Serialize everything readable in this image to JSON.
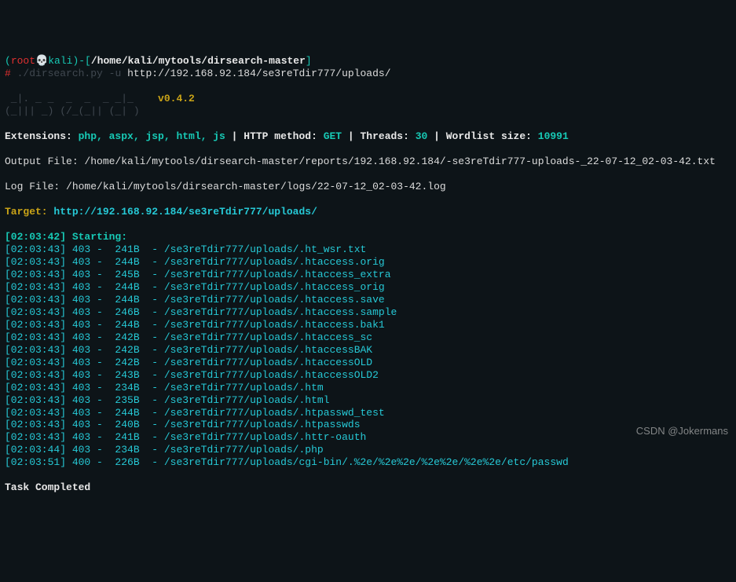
{
  "prompt": {
    "lparen": "(",
    "user": "root",
    "skull": "💀",
    "host": "kali",
    "rparen": ")-",
    "lbracket": "[",
    "cwd": "/home/kali/mytools/dirsearch-master",
    "rbracket": "]",
    "hash": "#",
    "cmd_bin": " ./dirsearch.py",
    "cmd_flag": " -u ",
    "cmd_url": "http://192.168.92.184/se3reTdir777/uploads/"
  },
  "logo": {
    "l1": " _|. _ _  _  _  _ _|_    ",
    "l2": "(_||| _) (/_(_|| (_| )   ",
    "version": "v0.4.2"
  },
  "ext": {
    "label": "Extensions: ",
    "val": "php, aspx, jsp, html, js",
    "sep1": " | ",
    "method_lbl": "HTTP method: ",
    "method": "GET",
    "sep2": " | ",
    "threads_lbl": "Threads: ",
    "threads": "30",
    "sep3": " | ",
    "wl_lbl": "Wordlist size: ",
    "wl": "10991"
  },
  "outfile": "Output File: /home/kali/mytools/dirsearch-master/reports/192.168.92.184/-se3reTdir777-uploads-_22-07-12_02-03-42.txt",
  "logfile": "Log File: /home/kali/mytools/dirsearch-master/logs/22-07-12_02-03-42.log",
  "target": {
    "label": "Target: ",
    "url": "http://192.168.92.184/se3reTdir777/uploads/"
  },
  "starting": "[02:03:42] Starting:",
  "results": [
    {
      "ts": "[02:03:43]",
      "code": " 403 -",
      "size": "  241B",
      "sep": "  - ",
      "path": "/se3reTdir777/uploads/.ht_wsr.txt"
    },
    {
      "ts": "[02:03:43]",
      "code": " 403 -",
      "size": "  244B",
      "sep": "  - ",
      "path": "/se3reTdir777/uploads/.htaccess.orig"
    },
    {
      "ts": "[02:03:43]",
      "code": " 403 -",
      "size": "  245B",
      "sep": "  - ",
      "path": "/se3reTdir777/uploads/.htaccess_extra"
    },
    {
      "ts": "[02:03:43]",
      "code": " 403 -",
      "size": "  244B",
      "sep": "  - ",
      "path": "/se3reTdir777/uploads/.htaccess_orig"
    },
    {
      "ts": "[02:03:43]",
      "code": " 403 -",
      "size": "  244B",
      "sep": "  - ",
      "path": "/se3reTdir777/uploads/.htaccess.save"
    },
    {
      "ts": "[02:03:43]",
      "code": " 403 -",
      "size": "  246B",
      "sep": "  - ",
      "path": "/se3reTdir777/uploads/.htaccess.sample"
    },
    {
      "ts": "[02:03:43]",
      "code": " 403 -",
      "size": "  244B",
      "sep": "  - ",
      "path": "/se3reTdir777/uploads/.htaccess.bak1"
    },
    {
      "ts": "[02:03:43]",
      "code": " 403 -",
      "size": "  242B",
      "sep": "  - ",
      "path": "/se3reTdir777/uploads/.htaccess_sc"
    },
    {
      "ts": "[02:03:43]",
      "code": " 403 -",
      "size": "  242B",
      "sep": "  - ",
      "path": "/se3reTdir777/uploads/.htaccessBAK"
    },
    {
      "ts": "[02:03:43]",
      "code": " 403 -",
      "size": "  242B",
      "sep": "  - ",
      "path": "/se3reTdir777/uploads/.htaccessOLD"
    },
    {
      "ts": "[02:03:43]",
      "code": " 403 -",
      "size": "  243B",
      "sep": "  - ",
      "path": "/se3reTdir777/uploads/.htaccessOLD2"
    },
    {
      "ts": "[02:03:43]",
      "code": " 403 -",
      "size": "  234B",
      "sep": "  - ",
      "path": "/se3reTdir777/uploads/.htm"
    },
    {
      "ts": "[02:03:43]",
      "code": " 403 -",
      "size": "  235B",
      "sep": "  - ",
      "path": "/se3reTdir777/uploads/.html"
    },
    {
      "ts": "[02:03:43]",
      "code": " 403 -",
      "size": "  244B",
      "sep": "  - ",
      "path": "/se3reTdir777/uploads/.htpasswd_test"
    },
    {
      "ts": "[02:03:43]",
      "code": " 403 -",
      "size": "  240B",
      "sep": "  - ",
      "path": "/se3reTdir777/uploads/.htpasswds"
    },
    {
      "ts": "[02:03:43]",
      "code": " 403 -",
      "size": "  241B",
      "sep": "  - ",
      "path": "/se3reTdir777/uploads/.httr-oauth"
    },
    {
      "ts": "[02:03:44]",
      "code": " 403 -",
      "size": "  234B",
      "sep": "  - ",
      "path": "/se3reTdir777/uploads/.php"
    },
    {
      "ts": "[02:03:51]",
      "code": " 400 -",
      "size": "  226B",
      "sep": "  - ",
      "path": "/se3reTdir777/uploads/cgi-bin/.%2e/%2e%2e/%2e%2e/%2e%2e/etc/passwd"
    }
  ],
  "done": "Task Completed",
  "watermark": "CSDN @Jokermans"
}
